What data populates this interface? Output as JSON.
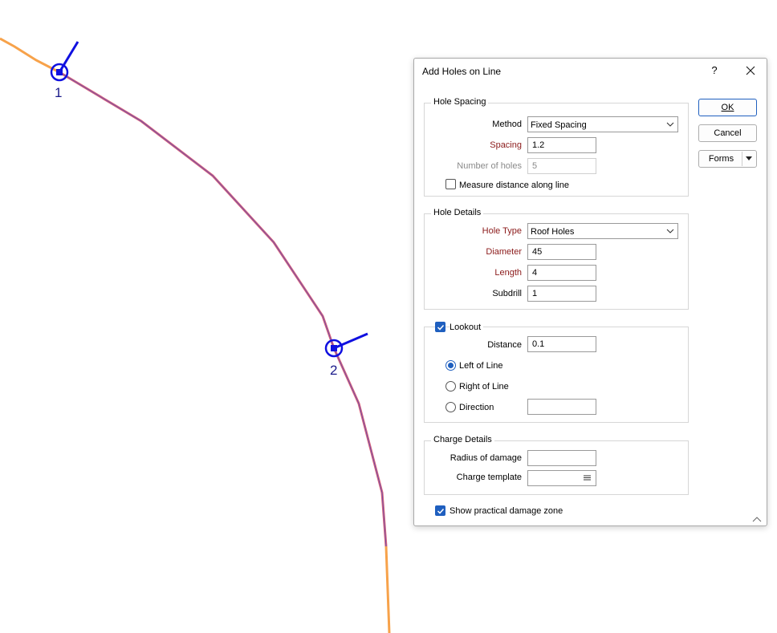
{
  "map": {
    "markers": [
      {
        "label": "1"
      },
      {
        "label": "2"
      }
    ]
  },
  "dialog": {
    "title": "Add Holes on Line",
    "help_label": "?",
    "buttons": {
      "ok": "OK",
      "cancel": "Cancel",
      "forms": "Forms"
    },
    "hole_spacing": {
      "title": "Hole Spacing",
      "method_label": "Method",
      "method_value": "Fixed Spacing",
      "spacing_label": "Spacing",
      "spacing_value": "1.2",
      "number_label": "Number of holes",
      "number_value": "5",
      "measure_label": "Measure distance along line",
      "measure_checked": false
    },
    "hole_details": {
      "title": "Hole Details",
      "type_label": "Hole Type",
      "type_value": "Roof Holes",
      "diameter_label": "Diameter",
      "diameter_value": "45",
      "length_label": "Length",
      "length_value": "4",
      "subdrill_label": "Subdrill",
      "subdrill_value": "1"
    },
    "lookout": {
      "title": "Lookout",
      "checked": true,
      "distance_label": "Distance",
      "distance_value": "0.1",
      "left_label": "Left of Line",
      "right_label": "Right of Line",
      "direction_label": "Direction",
      "direction_value": "",
      "selected": "Left of Line"
    },
    "charge_details": {
      "title": "Charge Details",
      "radius_label": "Radius of damage",
      "radius_value": "",
      "template_label": "Charge template",
      "template_value": ""
    },
    "show_zone_label": "Show practical damage zone",
    "show_zone_checked": true
  },
  "colors": {
    "line_orange": "#f7a24a",
    "line_selected": "#d9607a",
    "marker_blue": "#1010e0",
    "accent": "#1f5fbf",
    "required_label": "#8b1a1a"
  }
}
